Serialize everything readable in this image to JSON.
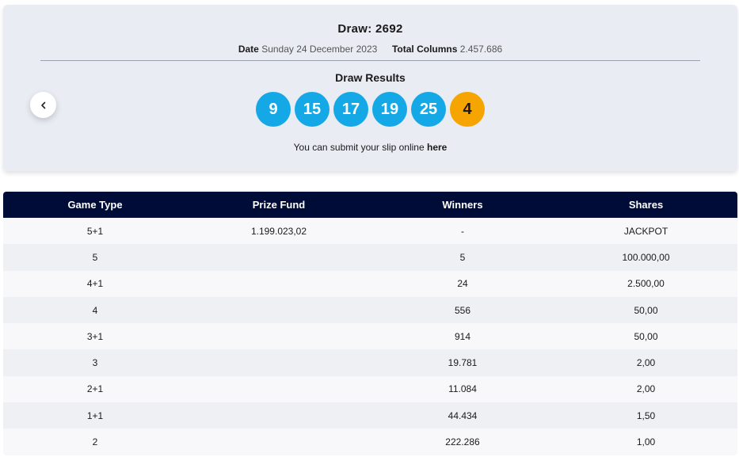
{
  "draw": {
    "title": "Draw: 2692",
    "date_label": "Date",
    "date_value": "Sunday 24 December 2023",
    "columns_label": "Total Columns",
    "columns_value": "2.457.686",
    "results_title": "Draw Results",
    "numbers": [
      "9",
      "15",
      "17",
      "19",
      "25"
    ],
    "bonus": "4",
    "submit_text": "You can submit your slip online",
    "submit_link": "here",
    "colors": {
      "ball": "#14a9e6",
      "bonus_ball": "#f5a400",
      "header": "#000c38"
    }
  },
  "table": {
    "headers": [
      "Game Type",
      "Prize Fund",
      "Winners",
      "Shares"
    ],
    "rows": [
      [
        "5+1",
        "1.199.023,02",
        "-",
        "JACKPOT"
      ],
      [
        "5",
        "",
        "5",
        "100.000,00"
      ],
      [
        "4+1",
        "",
        "24",
        "2.500,00"
      ],
      [
        "4",
        "",
        "556",
        "50,00"
      ],
      [
        "3+1",
        "",
        "914",
        "50,00"
      ],
      [
        "3",
        "",
        "19.781",
        "2,00"
      ],
      [
        "2+1",
        "",
        "11.084",
        "2,00"
      ],
      [
        "1+1",
        "",
        "44.434",
        "1,50"
      ],
      [
        "2",
        "",
        "222.286",
        "1,00"
      ]
    ]
  }
}
